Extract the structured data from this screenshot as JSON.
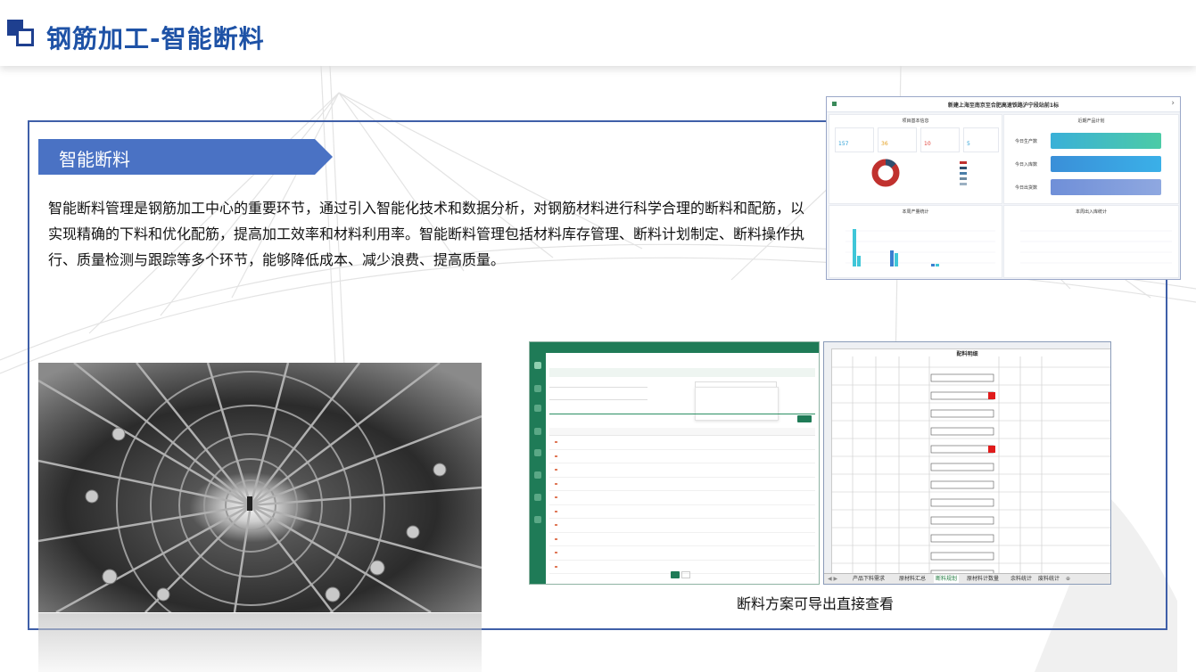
{
  "page": {
    "title": "钢筋加工-智能断料"
  },
  "section": {
    "tag": "智能断料",
    "description": "智能断料管理是钢筋加工中心的重要环节，通过引入智能化技术和数据分析，对钢筋材料进行科学合理的断料和配筋，以实现精确的下料和优化配筋，提高加工效率和材料利用率。智能断料管理包括材料库存管理、断料计划制定、断料操作执行、质量检测与跟踪等多个环节，能够降低成本、减少浪费、提高质量。"
  },
  "dashboard": {
    "project_name": "新建上海至南京至合肥高速铁路沪宁段站前1标",
    "panel_project": "项目基本信息",
    "panel_production": "近期产品计划",
    "panel_monthly": "本周产量统计",
    "panel_inout": "本周出入库统计",
    "today_production": "今日生产数",
    "today_in": "今日入库数",
    "today_out": "今日出货数"
  },
  "mgmt": {
    "button": "+ 新增配料"
  },
  "excel": {
    "sheet_title": "配料明细",
    "tabs": [
      "产品下料需求",
      "原材料汇总",
      "断料规划",
      "原材料计数量",
      "余料统计",
      "废料统计"
    ],
    "active_tab": 2
  },
  "caption": "断料方案可导出直接查看",
  "colors": {
    "title": "#1e52a6",
    "tag_bg": "#4a72c4",
    "frame": "#3f5fa8",
    "mgmt_green": "#1f7b57"
  }
}
